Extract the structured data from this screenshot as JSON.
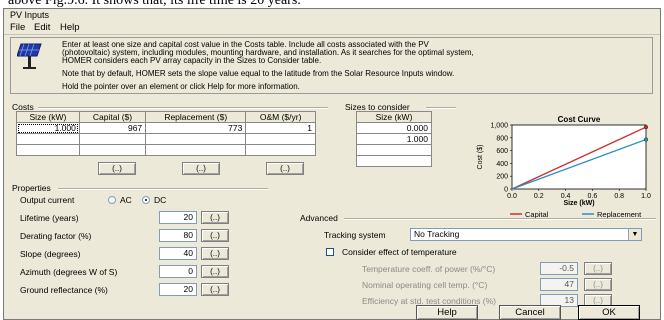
{
  "caption_fragment": "above Fig.9.6. It shows that, its life time is 20 years.",
  "window": {
    "title": "PV Inputs"
  },
  "menu": [
    "File",
    "Edit",
    "Help"
  ],
  "info": {
    "lines": [
      "Enter at least one size and capital cost value in the Costs table.  Include all costs associated with the PV",
      "(photovoltaic) system, including modules, mounting hardware, and installation. As it searches for the optimal system,",
      "HOMER considers each PV array capacity in the Sizes to Consider table.",
      "Note that by default, HOMER sets the slope value equal to the latitude from the Solar Resource Inputs window.",
      "Hold the pointer over an element or click Help for more information."
    ]
  },
  "costs": {
    "title": "Costs",
    "headers": [
      "Size (kW)",
      "Capital ($)",
      "Replacement ($)",
      "O&M ($/yr)"
    ],
    "rows": [
      [
        "1.000",
        "967",
        "773",
        "1"
      ]
    ],
    "buttons": [
      "(..)",
      "(..)",
      "(..)"
    ]
  },
  "sizes": {
    "title": "Sizes to consider",
    "header": "Size (kW)",
    "values": [
      "0.000",
      "1.000"
    ]
  },
  "chart_data": {
    "type": "line",
    "title": "Cost Curve",
    "xlabel": "Size (kW)",
    "ylabel": "Cost ($)",
    "x": [
      0,
      1.0
    ],
    "xticks": [
      "0.0",
      "0.2",
      "0.4",
      "0.6",
      "0.8",
      "1.0"
    ],
    "yticks": [
      "0",
      "200",
      "400",
      "600",
      "800",
      "1,000"
    ],
    "xlim": [
      0,
      1.0
    ],
    "ylim": [
      0,
      1000
    ],
    "series": [
      {
        "name": "Capital",
        "color": "#c83232",
        "values": [
          0,
          967
        ]
      },
      {
        "name": "Replacement",
        "color": "#2a8fc4",
        "values": [
          0,
          773
        ]
      }
    ],
    "legend": "bottom"
  },
  "properties": {
    "title": "Properties",
    "output_current_label": "Output current",
    "ac_label": "AC",
    "dc_label": "DC",
    "selected": "DC",
    "fields": [
      {
        "label": "Lifetime (years)",
        "value": "20",
        "button": "(..)"
      },
      {
        "label": "Derating factor (%)",
        "value": "80",
        "button": "(..)"
      },
      {
        "label": "Slope (degrees)",
        "value": "40",
        "button": "(..)"
      },
      {
        "label": "Azimuth (degrees W of S)",
        "value": "0",
        "button": "(..)"
      },
      {
        "label": "Ground reflectance (%)",
        "value": "20",
        "button": "(..)"
      }
    ]
  },
  "advanced": {
    "title": "Advanced",
    "tracking_label": "Tracking system",
    "tracking_value": "No Tracking",
    "temperature_label": "Consider effect of temperature",
    "temp_fields": [
      {
        "label": "Temperature coeff. of power (%/°C)",
        "value": "-0.5",
        "button": "(..)"
      },
      {
        "label": "Nominal operating cell temp. (°C)",
        "value": "47",
        "button": "(..)"
      },
      {
        "label": "Efficiency at std. test conditions (%)",
        "value": "13",
        "button": "(..)"
      }
    ]
  },
  "footer": {
    "help": "Help",
    "cancel": "Cancel",
    "ok": "OK"
  }
}
